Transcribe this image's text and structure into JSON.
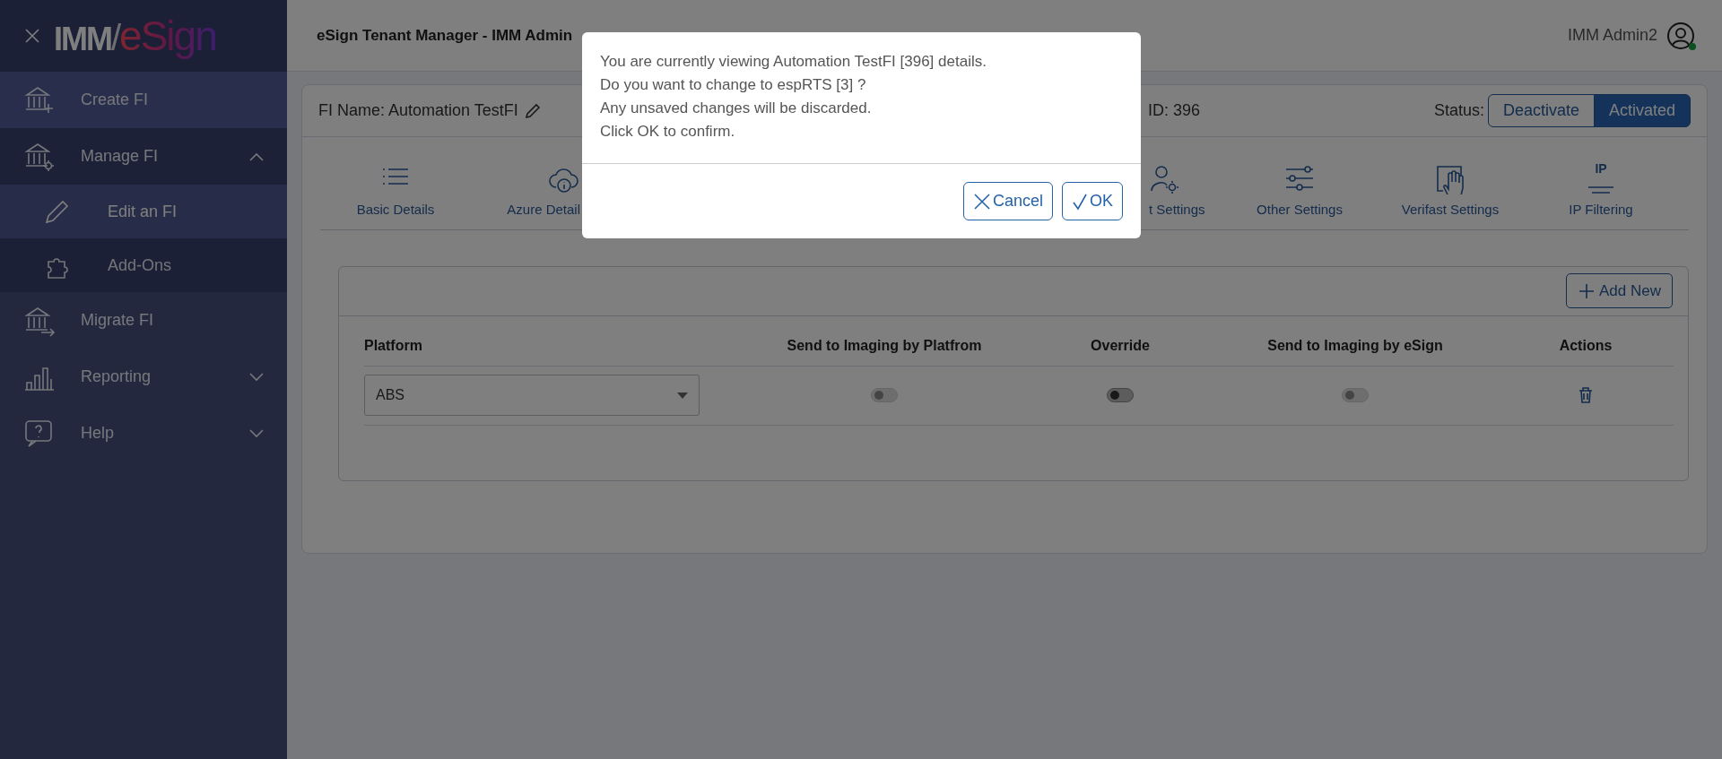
{
  "sidebar": {
    "logo": {
      "prefix": "IMM",
      "divider": "/",
      "name": "eSign"
    },
    "items": [
      {
        "label": "Create FI",
        "hover": true
      },
      {
        "label": "Manage FI",
        "expanded": true,
        "children": [
          {
            "label": "Edit an FI",
            "selected": true
          },
          {
            "label": "Add-Ons",
            "selected": false
          }
        ]
      },
      {
        "label": "Migrate FI"
      },
      {
        "label": "Reporting",
        "expanded": false
      },
      {
        "label": "Help",
        "expanded": false
      }
    ]
  },
  "header": {
    "title": "eSign Tenant Manager - IMM Admin",
    "user": "IMM Admin2",
    "online": true
  },
  "fi": {
    "name": "FI Name: Automation TestFI",
    "id": "ID: 396",
    "status_label": "Status:",
    "status": [
      {
        "label": "Deactivate",
        "selected": false
      },
      {
        "label": "Activated",
        "selected": true
      }
    ]
  },
  "tabs": [
    {
      "label": "Basic Details"
    },
    {
      "label": "Azure Detail"
    },
    {
      "label": "t Settings"
    },
    {
      "label": "Other Settings"
    },
    {
      "label": "Verifast Settings"
    },
    {
      "label": "IP Filtering",
      "icon_text": "IP"
    }
  ],
  "table": {
    "add_button": "Add New",
    "columns": [
      "Platform",
      "Send to Imaging by Platfrom",
      "Override",
      "Send to Imaging by eSign",
      "Actions"
    ],
    "rows": [
      {
        "platform": "ABS",
        "toggles": [
          {
            "on": false,
            "disabled": true
          },
          {
            "on": false,
            "disabled": false
          },
          {
            "on": false,
            "disabled": true
          }
        ]
      }
    ]
  },
  "dialog": {
    "lines": [
      "You are currently viewing Automation TestFI [396] details.",
      "Do you want to change to espRTS [3] ?",
      "Any unsaved changes will be discarded.",
      "Click OK to confirm."
    ],
    "buttons": [
      {
        "label": "Cancel",
        "kind": "cancel"
      },
      {
        "label": "OK",
        "kind": "ok"
      }
    ]
  }
}
